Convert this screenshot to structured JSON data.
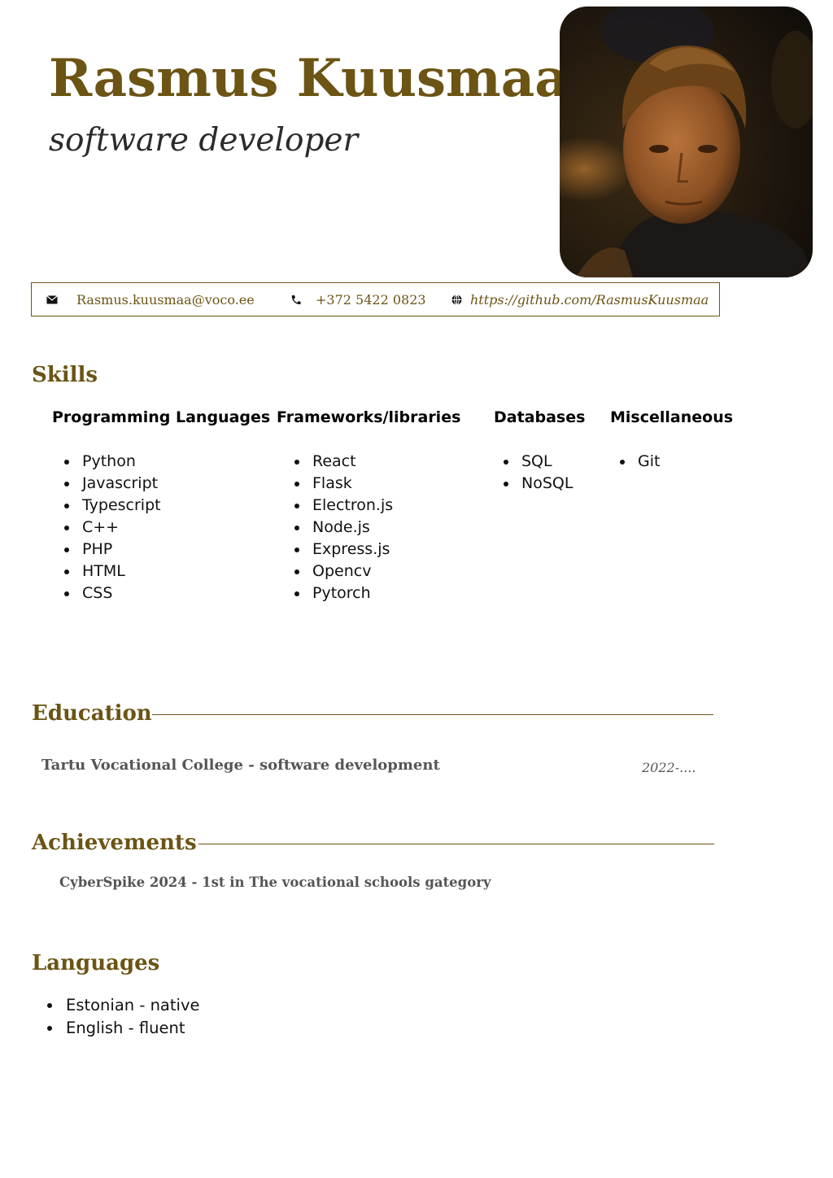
{
  "header": {
    "name": "Rasmus Kuusmaa",
    "title": "software developer"
  },
  "contact": {
    "email": "Rasmus.kuusmaa@voco.ee",
    "phone": "+372 5422 0823",
    "website": "https://github.com/RasmusKuusmaa",
    "icons": [
      "envelope-icon",
      "phone-icon",
      "globe-icon"
    ]
  },
  "skills": {
    "heading": "Skills",
    "columns": [
      {
        "title": "Programming Languages",
        "items": [
          "Python",
          "Javascript",
          "Typescript",
          "C++",
          "PHP",
          "HTML",
          "CSS"
        ]
      },
      {
        "title": "Frameworks/libraries",
        "items": [
          "React",
          "Flask",
          "Electron.js",
          "Node.js",
          "Express.js",
          "Opencv",
          "Pytorch"
        ]
      },
      {
        "title": "Databases",
        "items": [
          "SQL",
          "NoSQL"
        ]
      },
      {
        "title": "Miscellaneous",
        "items": [
          "Git"
        ]
      }
    ]
  },
  "education": {
    "heading": "Education",
    "entry": "Tartu Vocational College - software development",
    "date": "2022-...."
  },
  "achievements": {
    "heading": "Achievements",
    "entry": "CyberSpike 2024 - 1st in The vocational schools gategory"
  },
  "languages": {
    "heading": "Languages",
    "items": [
      "Estonian - native",
      "English - fluent"
    ]
  },
  "colors": {
    "accent": "#6b5414",
    "text": "#111111",
    "muted": "#555555"
  }
}
